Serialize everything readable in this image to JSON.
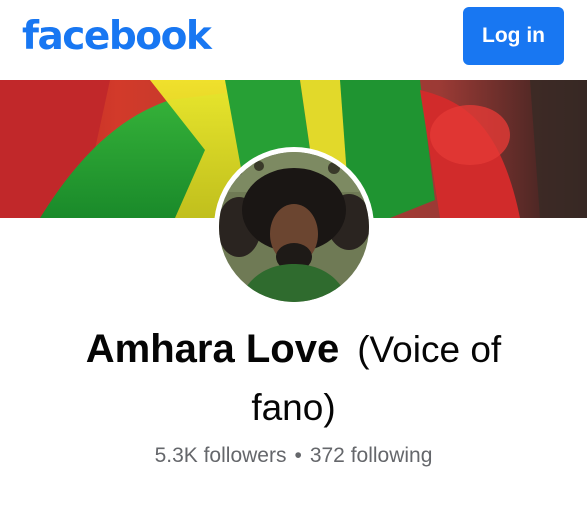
{
  "header": {
    "brand": "facebook",
    "login_label": "Log in"
  },
  "profile": {
    "name": "Amhara Love",
    "name_suffix_line1": "(Voice of",
    "name_suffix_line2": "fano)",
    "followers": "5.3K followers",
    "separator": "•",
    "following": "372 following"
  },
  "colors": {
    "brand_blue": "#1877f2",
    "text_primary": "#050505",
    "text_secondary": "#65676b"
  },
  "icons": {
    "cover": "cover-photo-flag",
    "avatar": "profile-picture"
  }
}
